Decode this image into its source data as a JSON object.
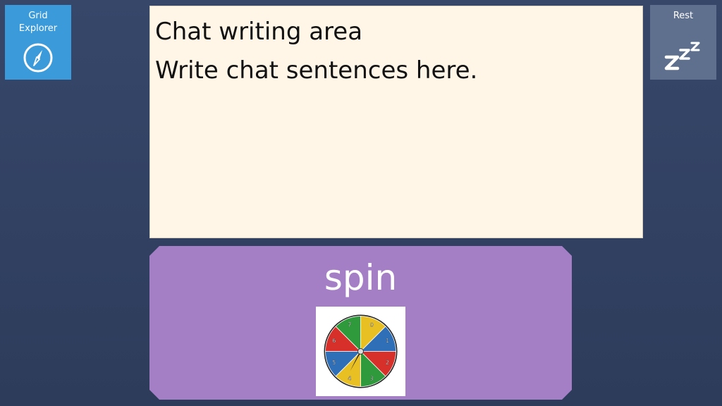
{
  "buttons": {
    "grid_explorer": {
      "label": "Grid\nExplorer",
      "icon": "compass-icon",
      "color": "#3b9bda"
    },
    "rest": {
      "label": "Rest",
      "icon": "zzz-icon",
      "color": "#5f708f"
    }
  },
  "chat_area": {
    "lines": [
      "Chat writing area",
      "Write chat sentences here."
    ],
    "background": "#fff6e8"
  },
  "spin_tile": {
    "label": "spin",
    "picture": "spinner-wheel-icon",
    "color": "#a57fc5",
    "wheel_numbers": [
      "0",
      "1",
      "2",
      "3",
      "4",
      "5",
      "6",
      "7"
    ],
    "wheel_colors": [
      "#e8c024",
      "#2f6fb8",
      "#d7302b",
      "#2f9a3c"
    ]
  }
}
